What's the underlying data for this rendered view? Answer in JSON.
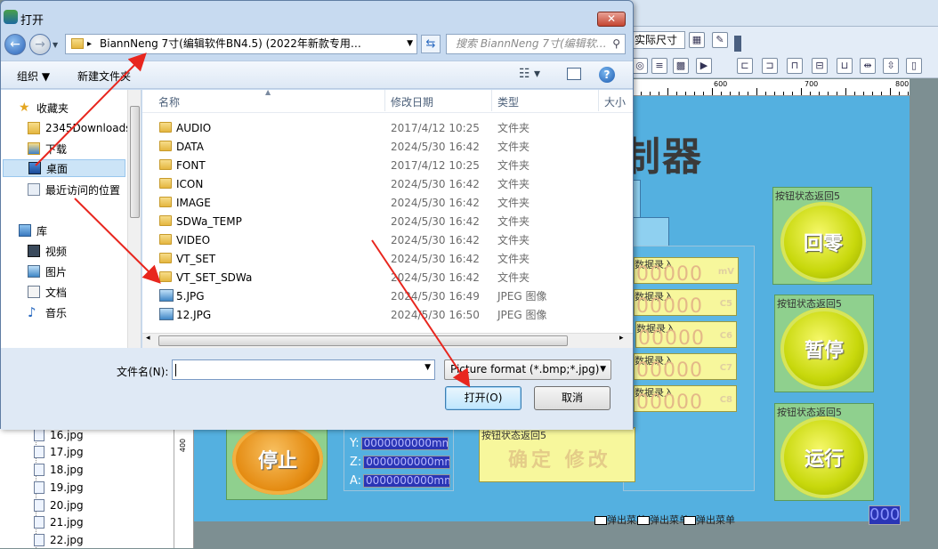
{
  "dialog": {
    "title": "打开",
    "close_label": "✕",
    "address": "BiannNeng 7寸(编辑软件BN4.5) (2022年新款专用…",
    "search_placeholder": "搜索 BiannNeng 7寸(编辑软…",
    "toolbar": {
      "organize": "组织 ▼",
      "new_folder": "新建文件夹"
    },
    "nav": {
      "favorites": "收藏夹",
      "fav_items": [
        "2345Downloads",
        "下载",
        "桌面",
        "最近访问的位置"
      ],
      "libraries": "库",
      "lib_items": [
        "视频",
        "图片",
        "文档",
        "音乐"
      ]
    },
    "columns": {
      "name": "名称",
      "date": "修改日期",
      "type": "类型",
      "size": "大小"
    },
    "files": [
      {
        "name": "AUDIO",
        "date": "2017/4/12 10:25",
        "type": "文件夹",
        "kind": "folder"
      },
      {
        "name": "DATA",
        "date": "2024/5/30 16:42",
        "type": "文件夹",
        "kind": "folder"
      },
      {
        "name": "FONT",
        "date": "2017/4/12 10:25",
        "type": "文件夹",
        "kind": "folder"
      },
      {
        "name": "ICON",
        "date": "2024/5/30 16:42",
        "type": "文件夹",
        "kind": "folder"
      },
      {
        "name": "IMAGE",
        "date": "2024/5/30 16:42",
        "type": "文件夹",
        "kind": "folder"
      },
      {
        "name": "SDWa_TEMP",
        "date": "2024/5/30 16:42",
        "type": "文件夹",
        "kind": "folder"
      },
      {
        "name": "VIDEO",
        "date": "2024/5/30 16:42",
        "type": "文件夹",
        "kind": "folder"
      },
      {
        "name": "VT_SET",
        "date": "2024/5/30 16:42",
        "type": "文件夹",
        "kind": "folder"
      },
      {
        "name": "VT_SET_SDWa",
        "date": "2024/5/30 16:42",
        "type": "文件夹",
        "kind": "folder"
      },
      {
        "name": "5.JPG",
        "date": "2024/5/30 16:49",
        "type": "JPEG 图像",
        "kind": "image"
      },
      {
        "name": "12.JPG",
        "date": "2024/5/30 16:50",
        "type": "JPEG 图像",
        "kind": "image"
      }
    ],
    "filename_label": "文件名(N):",
    "filename_value": "",
    "filter": "Picture format (*.bmp;*.jpg)",
    "open_button": "打开(O)",
    "cancel_button": "取消"
  },
  "app": {
    "zoom_combo": "实际尺寸",
    "ruler_labels": [
      "600",
      "700",
      "800"
    ],
    "title_text": "控制器",
    "buttons": [
      {
        "caption": "按钮状态返回5",
        "label": "回零"
      },
      {
        "caption": "按钮状态返回5",
        "label": "暂停"
      },
      {
        "caption": "按钮状态返回5",
        "label": "运行"
      }
    ],
    "stop_label": "停止",
    "data_rows": [
      {
        "caption": "数据录入",
        "value": "00000",
        "unit": "mV"
      },
      {
        "caption": "数据录入",
        "value": "00000",
        "unit": "C5"
      },
      {
        "caption": "数据录入",
        "value": "00000",
        "unit": "C6"
      },
      {
        "caption": "数据录入",
        "value": "00000",
        "unit": "C7"
      },
      {
        "caption": "数据录入",
        "value": "00000",
        "unit": "C8"
      }
    ],
    "coords": [
      {
        "axis": "Y:",
        "value": "0000000000mm"
      },
      {
        "axis": "Z:",
        "value": "0000000000mm"
      },
      {
        "axis": "A:",
        "value": "0000000000mm"
      }
    ],
    "confirm_caption": "按钮状态返回5",
    "confirm_label": "确定 修改",
    "menus": [
      "弹出菜单",
      "弹出菜单",
      "弹出菜单"
    ],
    "corner_value": "000",
    "tree_files": [
      "16.jpg",
      "17.jpg",
      "18.jpg",
      "19.jpg",
      "20.jpg",
      "21.jpg",
      "22.jpg"
    ],
    "vruler_label": "400"
  },
  "colors": {
    "canvas": "#54b0e0",
    "annotation_arrow": "#e8261e",
    "dialog_chrome": "#c7daf0"
  }
}
